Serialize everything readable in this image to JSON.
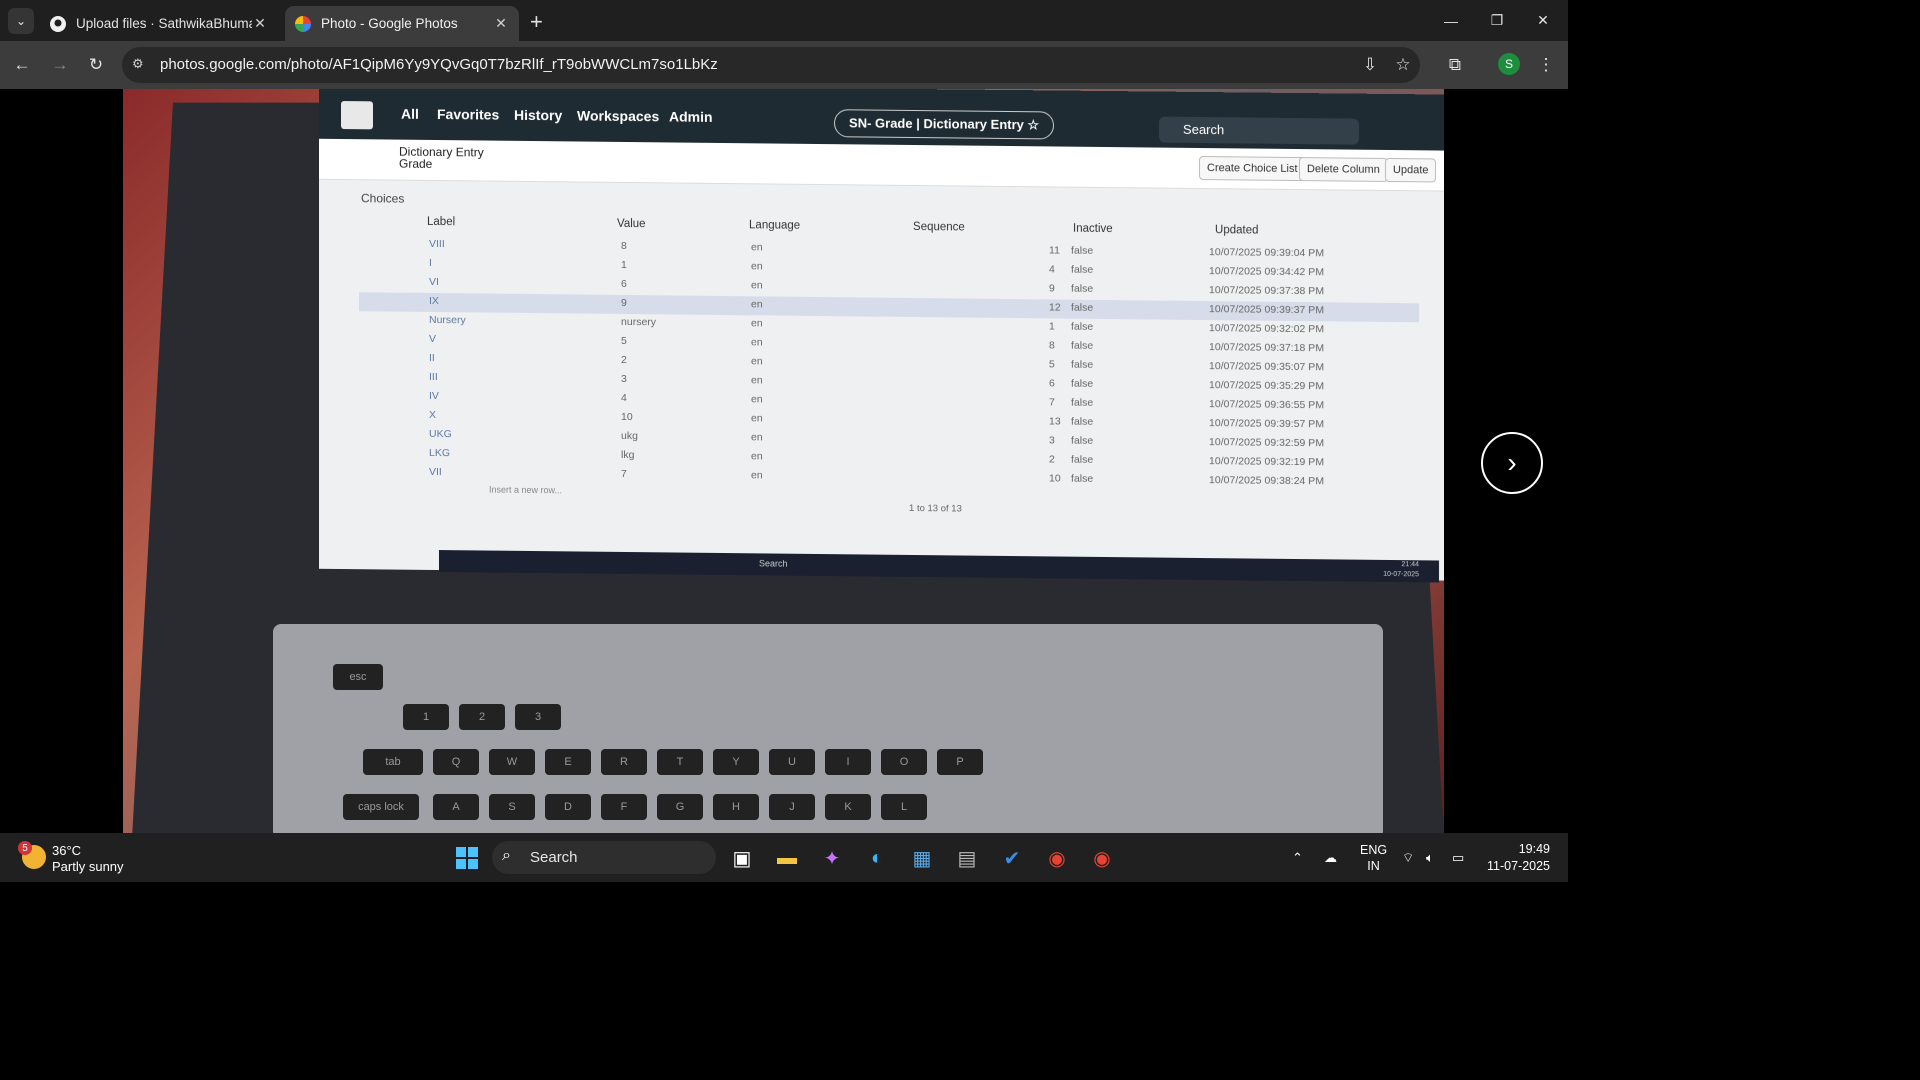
{
  "browser": {
    "tabs": [
      {
        "title": "Upload files · SathwikaBhuma/·"
      },
      {
        "title": "Photo - Google Photos"
      }
    ],
    "url": "photos.google.com/photo/AF1QipM6Yy9YQvGq0T7bzRlIf_rT9obWWCLm7so1LbKz",
    "profile_initial": "S"
  },
  "photo_screen": {
    "nav": [
      "All",
      "Favorites",
      "History",
      "Workspaces",
      "Admin"
    ],
    "context_title": "SN- Grade | Dictionary Entry ☆",
    "search_placeholder": "Search",
    "form_title_line1": "Dictionary Entry",
    "form_title_line2": "Grade",
    "buttons": [
      "Create Choice List",
      "Delete Column",
      "Update"
    ],
    "section": "Choices",
    "columns": [
      "Label",
      "Value",
      "Language",
      "Sequence",
      "Inactive",
      "Updated"
    ],
    "rows": [
      {
        "label": "VIII",
        "value": "8",
        "language": "en",
        "sequence": "11",
        "inactive": "false",
        "updated": "10/07/2025 09:39:04 PM"
      },
      {
        "label": "I",
        "value": "1",
        "language": "en",
        "sequence": "4",
        "inactive": "false",
        "updated": "10/07/2025 09:34:42 PM"
      },
      {
        "label": "VI",
        "value": "6",
        "language": "en",
        "sequence": "9",
        "inactive": "false",
        "updated": "10/07/2025 09:37:38 PM"
      },
      {
        "label": "IX",
        "value": "9",
        "language": "en",
        "sequence": "12",
        "inactive": "false",
        "updated": "10/07/2025 09:39:37 PM"
      },
      {
        "label": "Nursery",
        "value": "nursery",
        "language": "en",
        "sequence": "1",
        "inactive": "false",
        "updated": "10/07/2025 09:32:02 PM"
      },
      {
        "label": "V",
        "value": "5",
        "language": "en",
        "sequence": "8",
        "inactive": "false",
        "updated": "10/07/2025 09:37:18 PM"
      },
      {
        "label": "II",
        "value": "2",
        "language": "en",
        "sequence": "5",
        "inactive": "false",
        "updated": "10/07/2025 09:35:07 PM"
      },
      {
        "label": "III",
        "value": "3",
        "language": "en",
        "sequence": "6",
        "inactive": "false",
        "updated": "10/07/2025 09:35:29 PM"
      },
      {
        "label": "IV",
        "value": "4",
        "language": "en",
        "sequence": "7",
        "inactive": "false",
        "updated": "10/07/2025 09:36:55 PM"
      },
      {
        "label": "X",
        "value": "10",
        "language": "en",
        "sequence": "13",
        "inactive": "false",
        "updated": "10/07/2025 09:39:57 PM"
      },
      {
        "label": "UKG",
        "value": "ukg",
        "language": "en",
        "sequence": "3",
        "inactive": "false",
        "updated": "10/07/2025 09:32:59 PM"
      },
      {
        "label": "LKG",
        "value": "lkg",
        "language": "en",
        "sequence": "2",
        "inactive": "false",
        "updated": "10/07/2025 09:32:19 PM"
      },
      {
        "label": "VII",
        "value": "7",
        "language": "en",
        "sequence": "10",
        "inactive": "false",
        "updated": "10/07/2025 09:38:24 PM"
      }
    ],
    "insert_row": "Insert a new row...",
    "pager": "1 to 13 of 13",
    "screen_taskbar_search": "Search",
    "screen_clock_time": "21:44",
    "screen_clock_date": "10-07-2025"
  },
  "taskbar": {
    "weather_temp": "36°C",
    "weather_cond": "Partly sunny",
    "weather_badge": "5",
    "search_label": "Search",
    "lang_top": "ENG",
    "lang_bottom": "IN",
    "time": "19:49",
    "date": "11-07-2025"
  },
  "colors": {
    "chrome_tabstrip": "#1f1f1f",
    "chrome_toolbar": "#3c3c3c",
    "taskbar": "#202020",
    "sn_header": "#1f2b33",
    "highlight_row": "#d7dcea"
  }
}
